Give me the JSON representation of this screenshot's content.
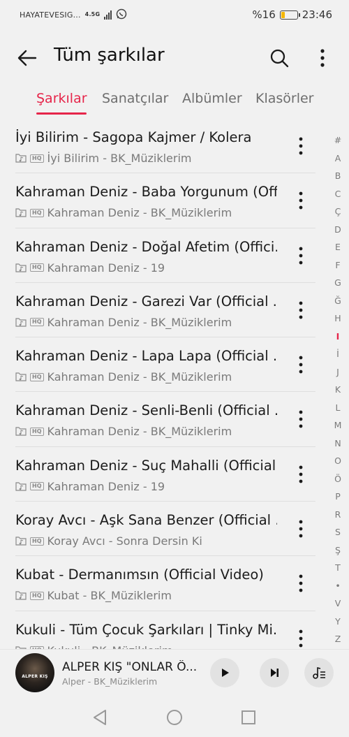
{
  "status_bar": {
    "carrier": "HAYATEVESIG...",
    "network": "4.5G",
    "battery_percent": "%16",
    "time": "23:46",
    "icons": [
      "signal-icon",
      "whatsapp-icon",
      "battery-icon"
    ]
  },
  "header": {
    "title": "Tüm şarkılar",
    "back_icon": "arrow-left-icon",
    "search_icon": "search-icon",
    "more_icon": "more-vertical-icon"
  },
  "tabs": [
    {
      "label": "Şarkılar",
      "active": true
    },
    {
      "label": "Sanatçılar",
      "active": false
    },
    {
      "label": "Albümler",
      "active": false
    },
    {
      "label": "Klasörler",
      "active": false
    }
  ],
  "songs": [
    {
      "title": "İyi Bilirim - Sagopa Kajmer / Kolera",
      "subtitle": "İyi Bilirim - BK_Müziklerim",
      "badge": "HQ"
    },
    {
      "title": "Kahraman Deniz - Baba Yorgunum (Off...",
      "subtitle": "Kahraman Deniz - BK_Müziklerim",
      "badge": "HQ"
    },
    {
      "title": "Kahraman Deniz - Doğal Afetim (Offici...",
      "subtitle": "Kahraman Deniz - 19",
      "badge": "HQ"
    },
    {
      "title": "Kahraman Deniz - Garezi Var (Official ...",
      "subtitle": "Kahraman Deniz - BK_Müziklerim",
      "badge": "HQ"
    },
    {
      "title": "Kahraman Deniz - Lapa Lapa (Official ...",
      "subtitle": "Kahraman Deniz - BK_Müziklerim",
      "badge": "HQ"
    },
    {
      "title": "Kahraman Deniz - Senli-Benli (Official ...",
      "subtitle": "Kahraman Deniz - BK_Müziklerim",
      "badge": "HQ"
    },
    {
      "title": "Kahraman Deniz - Suç Mahalli (Official ...",
      "subtitle": "Kahraman Deniz - 19",
      "badge": "HQ"
    },
    {
      "title": "Koray Avcı - Aşk Sana Benzer (Official ...",
      "subtitle": "Koray Avcı - Sonra Dersin Ki",
      "badge": "HQ"
    },
    {
      "title": "Kubat - Dermanımsın (Official Video)",
      "subtitle": "Kubat - BK_Müziklerim",
      "badge": "HQ"
    },
    {
      "title": "Kukuli - Tüm Çocuk Şarkıları | Tinky Mi...",
      "subtitle": "Kukuli - BK_Müziklerim",
      "badge": "HQ"
    }
  ],
  "alphabet": [
    "#",
    "A",
    "B",
    "C",
    "Ç",
    "D",
    "E",
    "F",
    "G",
    "Ğ",
    "H",
    "I",
    "İ",
    "J",
    "K",
    "L",
    "M",
    "N",
    "O",
    "Ö",
    "P",
    "R",
    "S",
    "Ş",
    "T",
    "•",
    "V",
    "Y",
    "Z"
  ],
  "alphabet_active": "I",
  "now_playing": {
    "title": "ALPER KIŞ  \"ONLAR Ö...",
    "subtitle": "Alper - BK_Müziklerim",
    "art_text": "ALPER KIŞ",
    "controls": [
      "play-icon",
      "skip-next-icon",
      "playlist-icon"
    ]
  },
  "nav": [
    "back-nav-icon",
    "home-nav-icon",
    "recents-nav-icon"
  ],
  "colors": {
    "accent": "#e6254a",
    "background": "#f1f1f1",
    "text": "#1b1b1b",
    "secondary_text": "#7a7a7a"
  }
}
